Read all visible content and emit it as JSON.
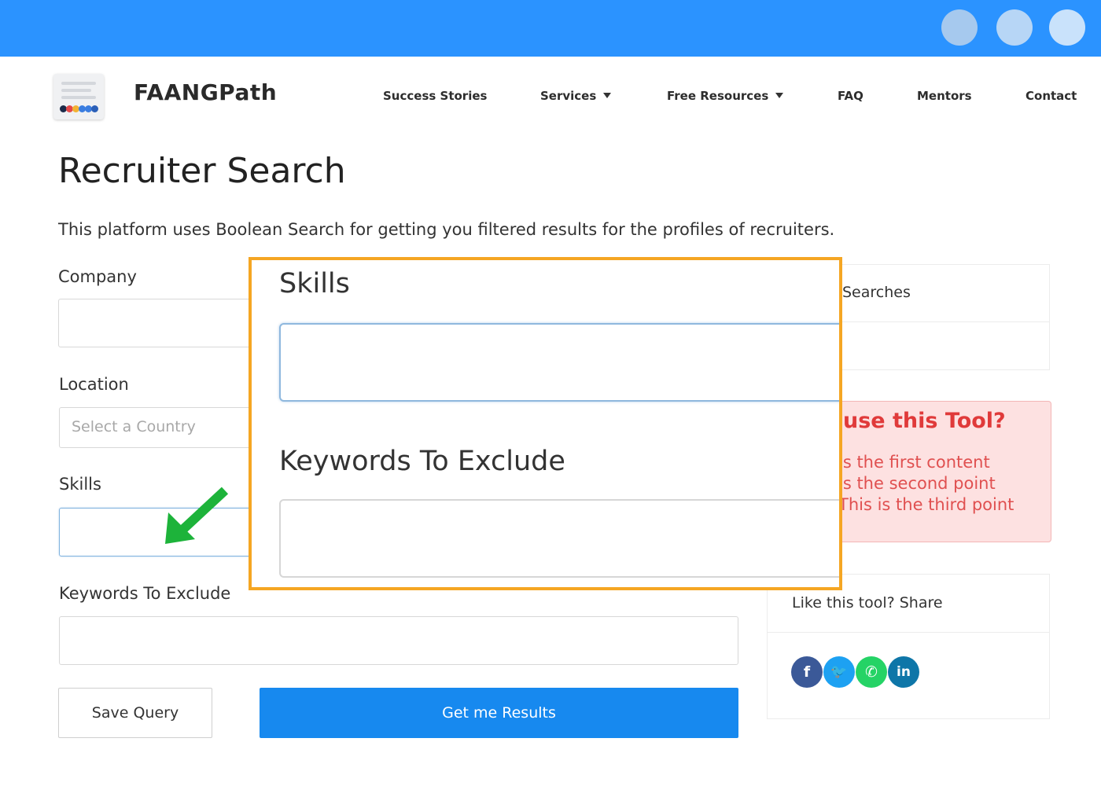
{
  "brand": {
    "name": "FAANGPath"
  },
  "nav": {
    "items": [
      {
        "label": "Success Stories",
        "has_caret": false
      },
      {
        "label": "Services",
        "has_caret": true
      },
      {
        "label": "Free Resources",
        "has_caret": true
      },
      {
        "label": "FAQ",
        "has_caret": false
      },
      {
        "label": "Mentors",
        "has_caret": false
      },
      {
        "label": "Contact",
        "has_caret": false
      }
    ]
  },
  "page": {
    "title": "Recruiter Search",
    "description": "This platform uses Boolean Search for getting you filtered results for the profiles of recruiters."
  },
  "form": {
    "company_label": "Company",
    "location_label": "Location",
    "location_placeholder": "Select a Country",
    "skills_label": "Skills",
    "exclude_label": "Keywords To Exclude",
    "save_button": "Save Query",
    "submit_button": "Get me Results"
  },
  "sidebar": {
    "searches_title": "Searches",
    "alert": {
      "title": "use this Tool?",
      "lines": [
        "is the first content",
        "is the second point",
        "This is the third point"
      ]
    },
    "share_title": "Like this tool? Share",
    "social": [
      {
        "icon": "facebook-icon",
        "glyph": "f",
        "color": "#3b5998"
      },
      {
        "icon": "twitter-icon",
        "glyph": "🐦",
        "color": "#1da1f2"
      },
      {
        "icon": "whatsapp-icon",
        "glyph": "✆",
        "color": "#25d366"
      },
      {
        "icon": "linkedin-icon",
        "glyph": "in",
        "color": "#0e76a8"
      }
    ]
  },
  "zoom": {
    "skills_label": "Skills",
    "exclude_label": "Keywords To Exclude"
  },
  "colors": {
    "topbar": "#2b93ff",
    "primary_button": "#1789ef",
    "highlight_border": "#f5a623",
    "arrow": "#1db33a",
    "alert_text": "#e03a3a"
  }
}
